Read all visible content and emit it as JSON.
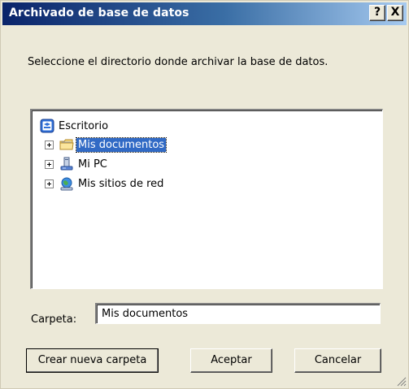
{
  "window": {
    "title": "Archivado de base de datos",
    "help_label": "?",
    "close_label": "X"
  },
  "instruction": "Seleccione el directorio donde archivar la base de datos.",
  "tree": {
    "root": {
      "label": "Escritorio",
      "icon": "desktop-icon"
    },
    "items": [
      {
        "label": "Mis documentos",
        "icon": "my-documents-folder-icon",
        "selected": true
      },
      {
        "label": "Mi PC",
        "icon": "my-computer-icon",
        "selected": false
      },
      {
        "label": "Mis sitios de red",
        "icon": "network-places-icon",
        "selected": false
      }
    ]
  },
  "folder": {
    "label": "Carpeta:",
    "value": "Mis documentos"
  },
  "buttons": {
    "new_folder": "Crear nueva carpeta",
    "ok": "Aceptar",
    "cancel": "Cancelar"
  },
  "colors": {
    "titlebar_start": "#0a246a",
    "titlebar_end": "#a6caf0",
    "dialog_bg": "#ece9d8",
    "selection": "#316ac5"
  }
}
